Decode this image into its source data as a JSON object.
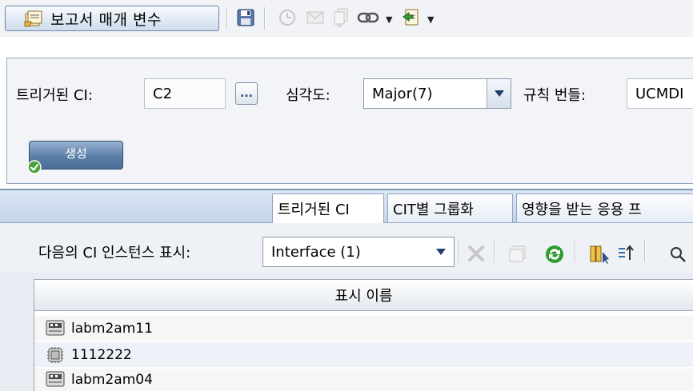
{
  "toolbar": {
    "report_params_label": "보고서 매개 변수",
    "icons": [
      "report-params-icon",
      "save-icon",
      "schedule-icon",
      "email-icon",
      "copy-icon",
      "link-icon",
      "export-icon"
    ]
  },
  "form": {
    "triggered_ci_label": "트리거된 CI:",
    "triggered_ci_value": "C2",
    "ellipsis_label": "...",
    "severity_label": "심각도:",
    "severity_value": "Major(7)",
    "rule_bundle_label": "규칙 번들:",
    "rule_bundle_value": "UCMDI",
    "create_label": "생성"
  },
  "tabs": [
    {
      "label": "트리거된 CI",
      "active": true
    },
    {
      "label": "CIT별 그룹화",
      "active": false
    },
    {
      "label": "영향을 받는 응용 프",
      "active": false
    }
  ],
  "filter": {
    "label": "다음의 CI 인스턴스 표시:",
    "value": "Interface (1)"
  },
  "table": {
    "header": "표시 이름",
    "rows": [
      {
        "name": "labm2am11",
        "icon": "server-icon"
      },
      {
        "name": "1112222",
        "icon": "chip-icon"
      },
      {
        "name": "labm2am04",
        "icon": "server-icon"
      }
    ]
  }
}
